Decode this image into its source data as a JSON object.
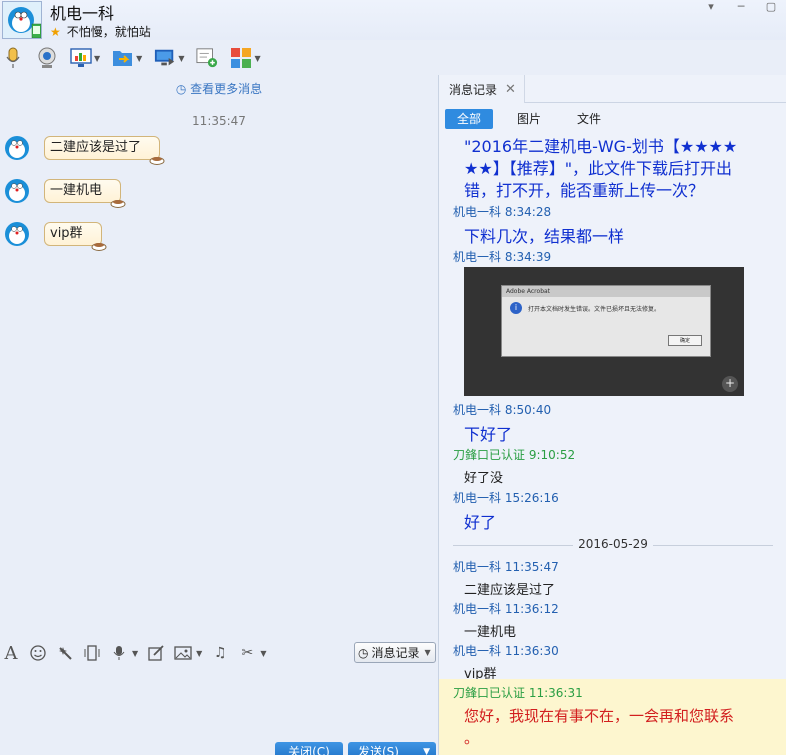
{
  "header": {
    "title": "机电一科",
    "signature": "不怕慢，就怕站",
    "win_controls": [
      "▾",
      "─",
      "▢"
    ]
  },
  "toolbar": {
    "items": [
      "voice-call-icon",
      "video-call-icon",
      "remote-desktop-icon",
      "send-file-icon",
      "screen-share-icon",
      "add-group-icon",
      "apps-icon"
    ]
  },
  "chat": {
    "more_messages": "查看更多消息",
    "time": "11:35:47",
    "messages": [
      {
        "text": "二建应该是过了"
      },
      {
        "text": "一建机电"
      },
      {
        "text": "vip群"
      }
    ]
  },
  "input_toolbar": {
    "font_glyph": "A",
    "history_button": "消息记录"
  },
  "buttons": {
    "close": "关闭(C)",
    "send": "发送(S)"
  },
  "right_panel": {
    "tab_label": "消息记录",
    "filters": [
      "全部",
      "图片",
      "文件"
    ],
    "log": {
      "top_lines": [
        "\"2016年二建机电-WG-划书【★★★★",
        "★★】【推荐】\"，此文件下载后打开出",
        "错，打不开，能否重新上传一次？"
      ],
      "entries": [
        {
          "sender": "机电一科",
          "time": "8:34:28",
          "text": "下料几次，结果都一样"
        },
        {
          "sender": "机电一科",
          "time": "8:34:39",
          "text": ""
        },
        {
          "sender": "机电一科",
          "time": "8:50:40",
          "text": "下好了"
        },
        {
          "sender": "刀鋒口已认证",
          "time": "9:10:52",
          "text": "好了没"
        },
        {
          "sender": "机电一科",
          "time": "15:26:16",
          "text": "好了"
        }
      ],
      "date_separator": "2016-05-29",
      "entries2": [
        {
          "sender": "机电一科",
          "time": "11:35:47",
          "text": "二建应该是过了"
        },
        {
          "sender": "机电一科",
          "time": "11:36:12",
          "text": "一建机电"
        },
        {
          "sender": "机电一科",
          "time": "11:36:30",
          "text": "vip群"
        }
      ],
      "auto_reply": {
        "sender": "刀鋒口已认证",
        "time": "11:36:31",
        "line1": "您好，我现在有事不在，一会再和您联系",
        "line2": "。"
      },
      "screenshot": {
        "window_title": "Adobe Acrobat",
        "message": "打开本文档时发生错误。文件已损坏且无法修复。",
        "ok_button": "确定"
      }
    }
  },
  "colors": {
    "accent": "#2f8be0",
    "sender_blue": "#2360b0",
    "sender_green": "#2a9e43",
    "auto_reply_red": "#d21f1f"
  }
}
